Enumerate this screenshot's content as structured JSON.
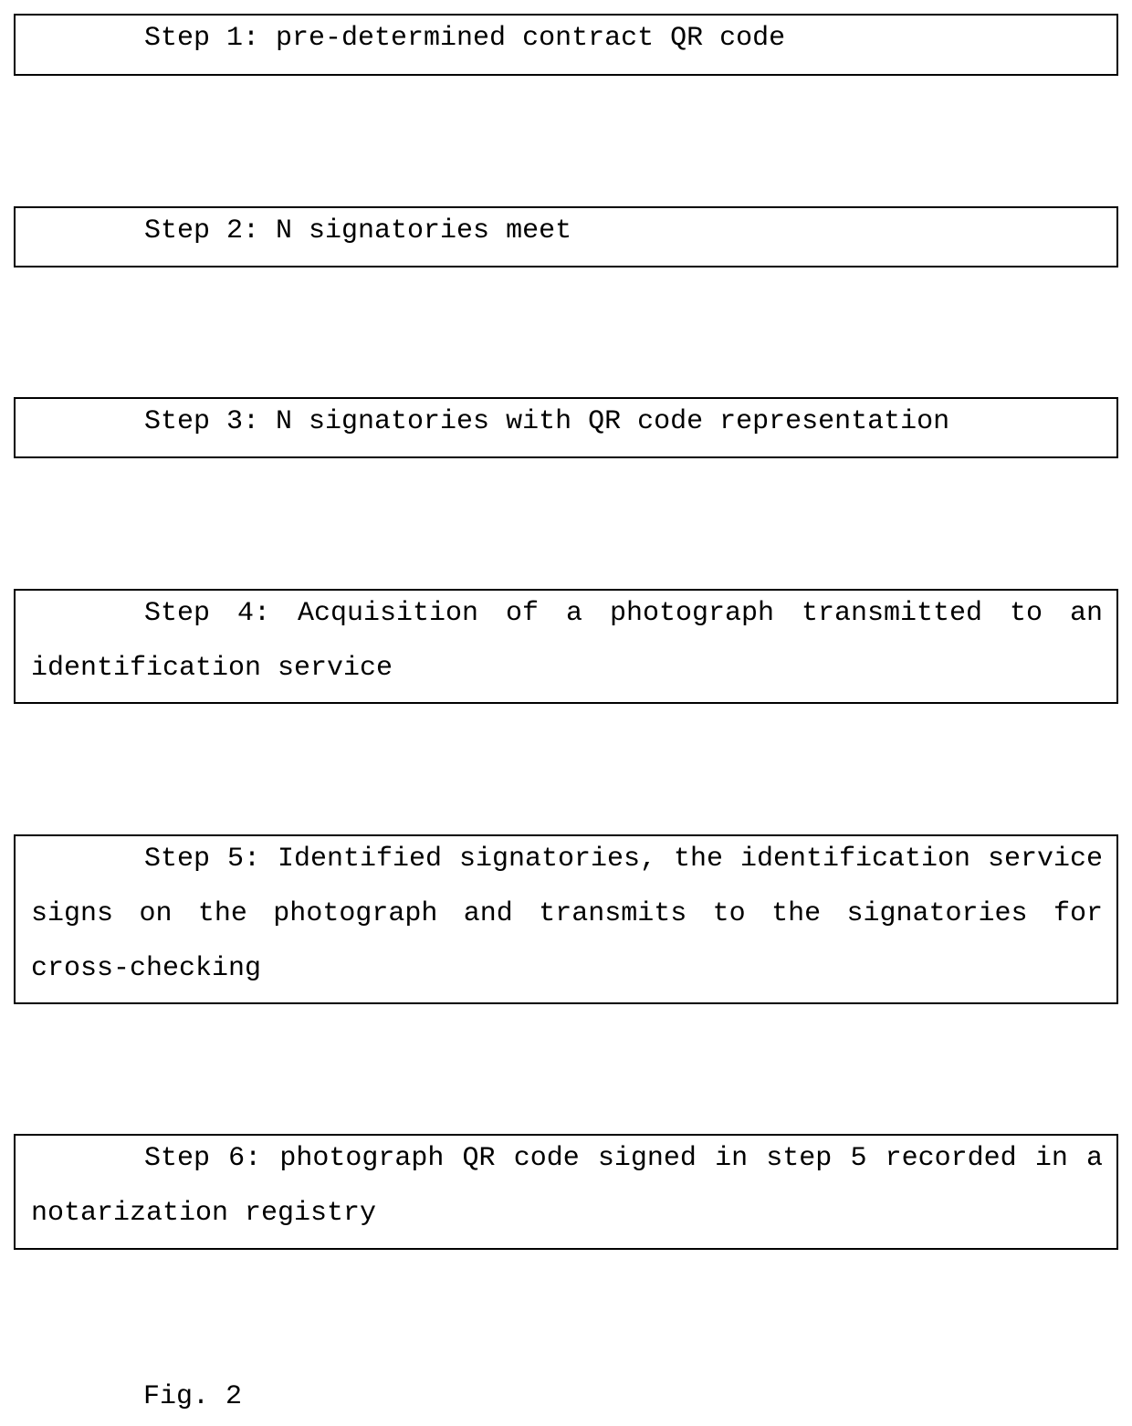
{
  "steps": [
    {
      "label": "Step 1: pre-determined contract QR code"
    },
    {
      "label": "Step 2: N signatories meet"
    },
    {
      "label": "Step 3: N signatories with QR code representation"
    },
    {
      "label": "Step 4: Acquisition of a photograph transmitted to an identification service"
    },
    {
      "label": "Step 5: Identified signatories, the identification service signs on the photograph and transmits to the signatories for cross-checking"
    },
    {
      "label": "Step 6: photograph QR code signed in step 5 recorded in a notarization registry"
    }
  ],
  "figure": {
    "caption": "Fig. 2"
  }
}
